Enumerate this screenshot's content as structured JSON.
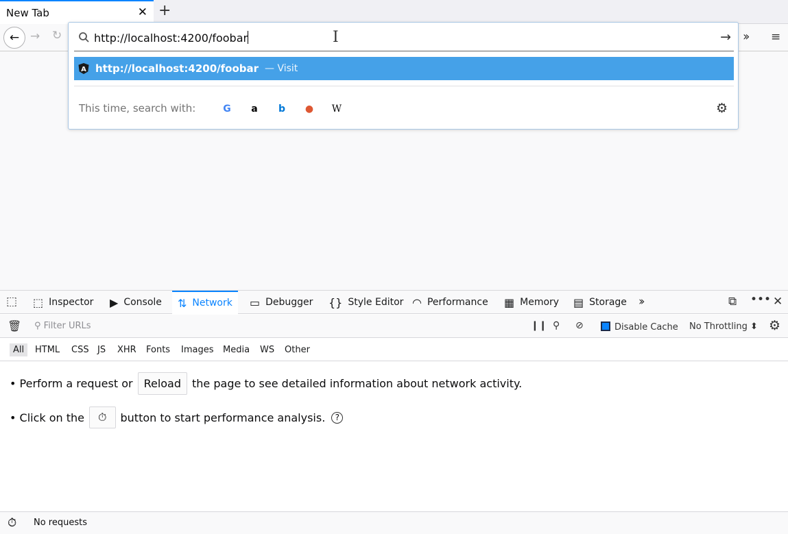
{
  "browser": {
    "tab_title": "New Tab",
    "tab_close": "✕",
    "new_tab": "+"
  },
  "urlbar": {
    "value": "http://localhost:4200/foobar",
    "result_url": "http://localhost:4200/foobar",
    "result_action": "— Visit",
    "search_with_label": "This time, search with:",
    "engines": [
      "Google",
      "Amazon",
      "Bing",
      "DuckDuckGo",
      "Wikipedia"
    ],
    "engine_glyphs": [
      "G",
      "a",
      "b",
      "●",
      "W"
    ],
    "engine_colors": [
      "#4285f4",
      "#000000",
      "#0078d7",
      "#de5833",
      "#000000"
    ]
  },
  "devtools": {
    "tabs": [
      {
        "label": "Inspector",
        "icon": "inspector-icon",
        "glyph": "⬚"
      },
      {
        "label": "Console",
        "icon": "console-icon",
        "glyph": "▶"
      },
      {
        "label": "Network",
        "icon": "network-icon",
        "glyph": "⇅"
      },
      {
        "label": "Debugger",
        "icon": "debugger-icon",
        "glyph": "▭"
      },
      {
        "label": "Style Editor",
        "icon": "style-editor-icon",
        "glyph": "{}"
      },
      {
        "label": "Performance",
        "icon": "performance-icon",
        "glyph": "◠"
      },
      {
        "label": "Memory",
        "icon": "memory-icon",
        "glyph": "▦"
      },
      {
        "label": "Storage",
        "icon": "storage-icon",
        "glyph": "▤"
      }
    ],
    "active_tab": "Network",
    "filter_placeholder": "Filter URLs",
    "disable_cache_label": "Disable Cache",
    "throttling_label": "No Throttling ⬍",
    "types": [
      "All",
      "HTML",
      "CSS",
      "JS",
      "XHR",
      "Fonts",
      "Images",
      "Media",
      "WS",
      "Other"
    ],
    "empty_line1_pre": "• Perform a request or",
    "reload_button": "Reload",
    "empty_line1_post": "the page to see detailed information about network activity.",
    "empty_line2_pre": "• Click on the",
    "empty_line2_post": "button to start performance analysis.",
    "help_glyph": "?",
    "status_text": "No requests"
  },
  "colors": {
    "accent": "#0a84ff",
    "result_highlight": "#45a1e8"
  }
}
